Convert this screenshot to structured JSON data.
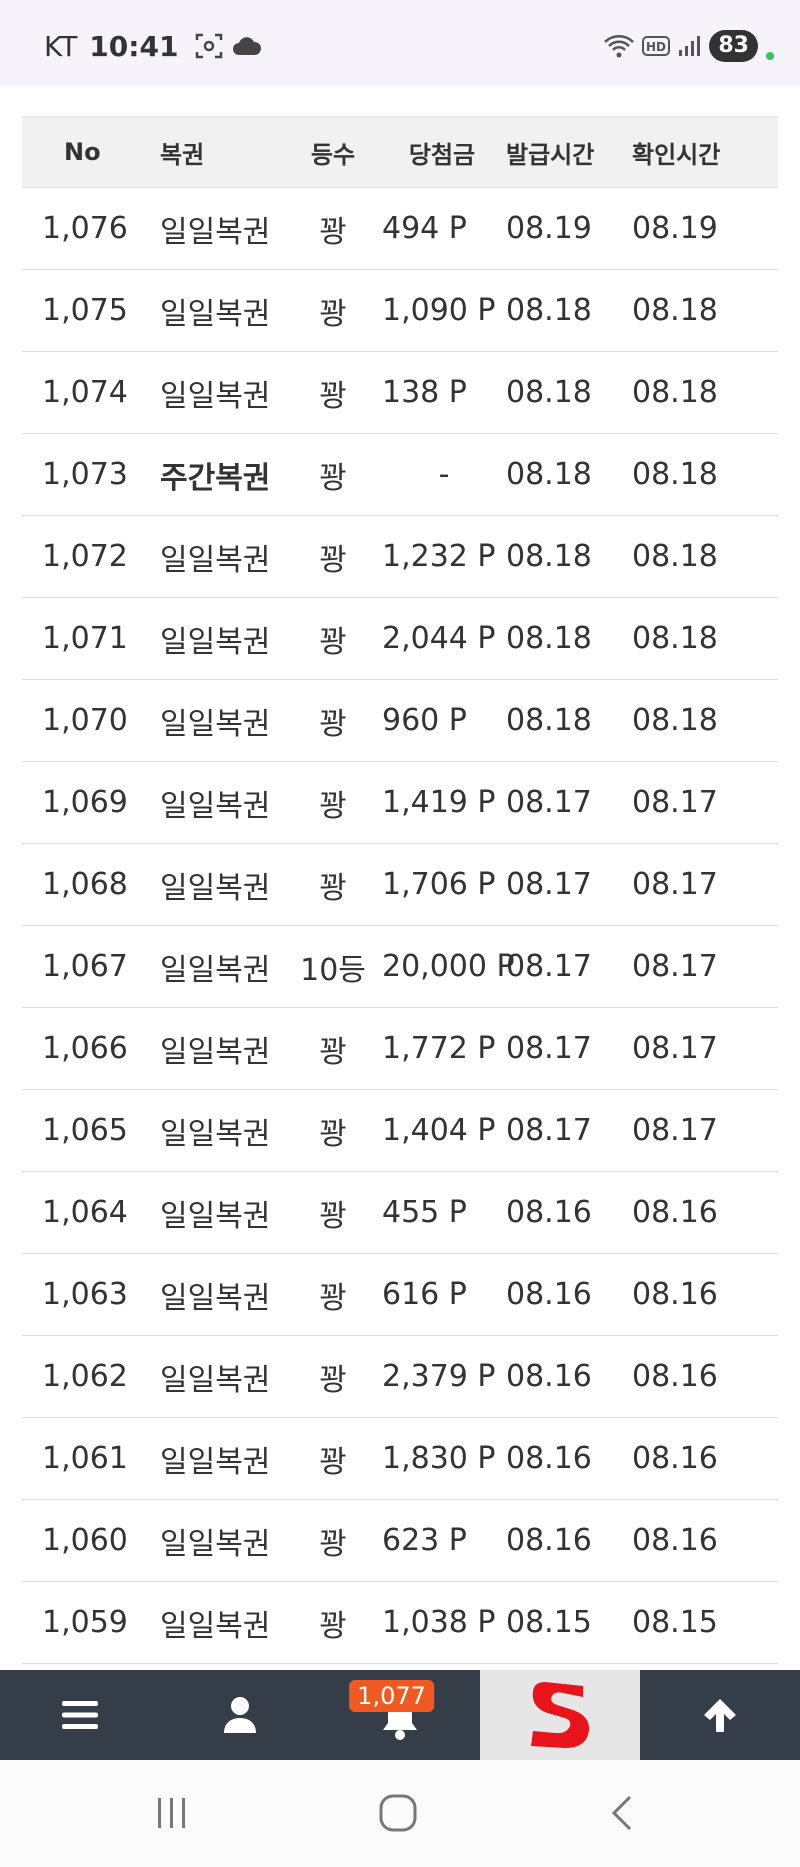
{
  "status_bar": {
    "carrier": "KT",
    "time": "10:41",
    "battery": "83",
    "icons": [
      "screenshot-icon",
      "cloud-icon",
      "wifi-icon",
      "hd-icon",
      "signal-icon"
    ]
  },
  "table": {
    "headers": [
      "No",
      "복권",
      "등수",
      "당첨금",
      "발급시간",
      "확인시간"
    ],
    "rows": [
      {
        "no": "1,076",
        "type": "일일복권",
        "rank": "꽝",
        "prize": "494 P",
        "issued": "08.19",
        "checked": "08.19"
      },
      {
        "no": "1,075",
        "type": "일일복권",
        "rank": "꽝",
        "prize": "1,090 P",
        "issued": "08.18",
        "checked": "08.18"
      },
      {
        "no": "1,074",
        "type": "일일복권",
        "rank": "꽝",
        "prize": "138 P",
        "issued": "08.18",
        "checked": "08.18"
      },
      {
        "no": "1,073",
        "type": "주간복권",
        "rank": "꽝",
        "prize": "-",
        "issued": "08.18",
        "checked": "08.18"
      },
      {
        "no": "1,072",
        "type": "일일복권",
        "rank": "꽝",
        "prize": "1,232 P",
        "issued": "08.18",
        "checked": "08.18"
      },
      {
        "no": "1,071",
        "type": "일일복권",
        "rank": "꽝",
        "prize": "2,044 P",
        "issued": "08.18",
        "checked": "08.18"
      },
      {
        "no": "1,070",
        "type": "일일복권",
        "rank": "꽝",
        "prize": "960 P",
        "issued": "08.18",
        "checked": "08.18"
      },
      {
        "no": "1,069",
        "type": "일일복권",
        "rank": "꽝",
        "prize": "1,419 P",
        "issued": "08.17",
        "checked": "08.17"
      },
      {
        "no": "1,068",
        "type": "일일복권",
        "rank": "꽝",
        "prize": "1,706 P",
        "issued": "08.17",
        "checked": "08.17"
      },
      {
        "no": "1,067",
        "type": "일일복권",
        "rank": "10등",
        "prize": "20,000 P",
        "issued": "08.17",
        "checked": "08.17"
      },
      {
        "no": "1,066",
        "type": "일일복권",
        "rank": "꽝",
        "prize": "1,772 P",
        "issued": "08.17",
        "checked": "08.17"
      },
      {
        "no": "1,065",
        "type": "일일복권",
        "rank": "꽝",
        "prize": "1,404 P",
        "issued": "08.17",
        "checked": "08.17"
      },
      {
        "no": "1,064",
        "type": "일일복권",
        "rank": "꽝",
        "prize": "455 P",
        "issued": "08.16",
        "checked": "08.16"
      },
      {
        "no": "1,063",
        "type": "일일복권",
        "rank": "꽝",
        "prize": "616 P",
        "issued": "08.16",
        "checked": "08.16"
      },
      {
        "no": "1,062",
        "type": "일일복권",
        "rank": "꽝",
        "prize": "2,379 P",
        "issued": "08.16",
        "checked": "08.16"
      },
      {
        "no": "1,061",
        "type": "일일복권",
        "rank": "꽝",
        "prize": "1,830 P",
        "issued": "08.16",
        "checked": "08.16"
      },
      {
        "no": "1,060",
        "type": "일일복권",
        "rank": "꽝",
        "prize": "623 P",
        "issued": "08.16",
        "checked": "08.16"
      },
      {
        "no": "1,059",
        "type": "일일복권",
        "rank": "꽝",
        "prize": "1,038 P",
        "issued": "08.15",
        "checked": "08.15"
      }
    ]
  },
  "bottom_nav": {
    "items": [
      "menu-icon",
      "user-icon",
      "bell-icon",
      "site-logo",
      "arrow-up-icon"
    ],
    "notification_count": "1,077"
  },
  "system_nav": {
    "items": [
      "recents-icon",
      "home-icon",
      "back-icon"
    ]
  },
  "colors": {
    "nav_background": "#353d48",
    "badge": "#f05a22",
    "logo_red": "#e8141c"
  }
}
